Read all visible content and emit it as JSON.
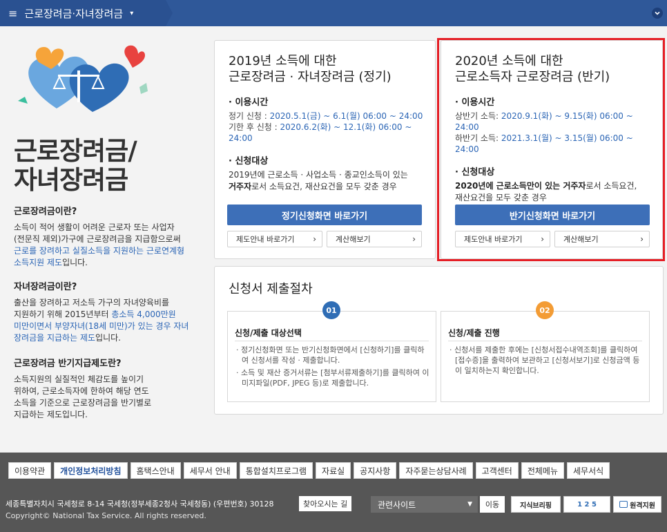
{
  "topbar": {
    "menu_label": "근로장려금·자녀장려금",
    "burger_icon": "≡",
    "caret_icon": "▾",
    "toggle_icon": "⌄"
  },
  "left": {
    "title_line1": "근로장려금/",
    "title_line2": "자녀장려금",
    "sec1": {
      "heading": "근로장려금이란?",
      "p1": "소득이 적어 생활이 어려운 근로자 또는 사업자",
      "p2": "(전문직 제외)가구에 근로장려금을 지급함으로써",
      "p3_hl": "근로를 장려하고 실질소득을 지원하는 근로연계형",
      "p4_hl": "소득지원 제도",
      "p4_tail": "입니다."
    },
    "sec2": {
      "heading": "자녀장려금이란?",
      "p1": "출산을 장려하고 저소득 가구의 자녀양육비를",
      "p2a": "지원하기 위해 2015년부터 ",
      "p2_hl": "총소득 4,000만원",
      "p3_hl": "미만이면서 부양자녀(18세 미만)가 있는 경우 자녀",
      "p4_hl": "장려금을 지급하는 제도",
      "p4_tail": "입니다."
    },
    "sec3": {
      "heading": "근로장려금 반기지급제도란?",
      "p1": "소득지원의 실질적인 체감도를 높이기",
      "p2": "위하여, 근로소득자에 한하여 해당 연도",
      "p3": "소득을 기준으로 근로장려금을 반기별로",
      "p4": "지급하는 제도입니다."
    }
  },
  "card2019": {
    "title1": "2019년 소득에 대한",
    "title2": "근로장려금 · 자녀장려금 (정기)",
    "time_label": "· 이용시간",
    "time1_label": "정기 신청 : ",
    "time1_value": "2020.5.1(금) ~ 6.1(월) 06:00 ~ 24:00",
    "time2_label": "기한 후 신청 : ",
    "time2_value": "2020.6.2(화) ~ 12.1(화) 06:00 ~ 24:00",
    "target_label": "· 신청대상",
    "target1": "2019년에 근로소득 · 사업소득 · 종교인소득이 있는",
    "target2_b": "거주자",
    "target2_tail": "로서 소득요건, 재산요건을 모두 갖춘 경우",
    "apply_label": "정기신청화면 바로가기",
    "guide_label": "제도안내 바로가기",
    "calc_label": "계산해보기",
    "arrow": "›"
  },
  "card2020": {
    "title1": "2020년 소득에 대한",
    "title2": "근로소득자 근로장려금 (반기)",
    "time_label": "· 이용시간",
    "time1_label": "상반기 소득: ",
    "time1_value": "2020.9.1(화) ~ 9.15(화) 06:00 ~ 24:00",
    "time2_label": "하반기 소득: ",
    "time2_value": "2021.3.1(월) ~ 3.15(월) 06:00 ~ 24:00",
    "target_label": "· 신청대상",
    "target1_b": "2020년에 근로소득만이 있는 거주자",
    "target1_tail": "로서 소득요건,",
    "target2": "재산요건을 모두 갖춘 경우",
    "apply_label": "반기신청화면 바로가기",
    "guide_label": "제도안내 바로가기",
    "calc_label": "계산해보기",
    "arrow": "›"
  },
  "procedure": {
    "title": "신청서 제출절차",
    "step1": {
      "num": "01",
      "heading": "신청/제출 대상선택",
      "b1": "· 정기신청화면 또는 반기신청화면에서 [신청하기]를 클릭하여 신청서를 작성 · 제출합니다.",
      "b2": "· 소득 및 재산 증거서류는 [첨부서류제출하기]를 클릭하여 이미지파일(PDF, JPEG 등)로 제출합니다."
    },
    "step2": {
      "num": "02",
      "heading": "신청/제출 진행",
      "b1": "· 신청서를 제출한 후에는 [신청서접수내역조회]를 클릭하여 [접수증]을 출력하여 보관하고 [신청서보기]로 신청금액 등이 일치하는지 확인합니다."
    }
  },
  "footer": {
    "links": [
      "이용약관",
      "개인정보처리방침",
      "홈택스안내",
      "세무서 안내",
      "통합설치프로그램",
      "자료실",
      "공지사항",
      "자주묻는상담사례",
      "고객센터",
      "전체메뉴",
      "세무서식"
    ],
    "address": "세종특별자치시 국세청로 8-14 국세청(정부세종2청사 국세청동) (우편번호) 30128",
    "find_label": "찾아오시는 길",
    "copyright": "Copyright© National Tax Service. All rights reserved.",
    "related_label": "관련사이트",
    "go_label": "이동",
    "banner1": "지식브리핑",
    "banner2": "1 2 5",
    "banner3": "원격지원"
  },
  "colors": {
    "topbar": "#2f5899",
    "accent_blue": "#2b65b5",
    "button_blue": "#3d6fb8",
    "highlight_red": "#e51e25",
    "step1": "#2f6db5",
    "step2": "#f39c35",
    "footer": "#565656"
  }
}
